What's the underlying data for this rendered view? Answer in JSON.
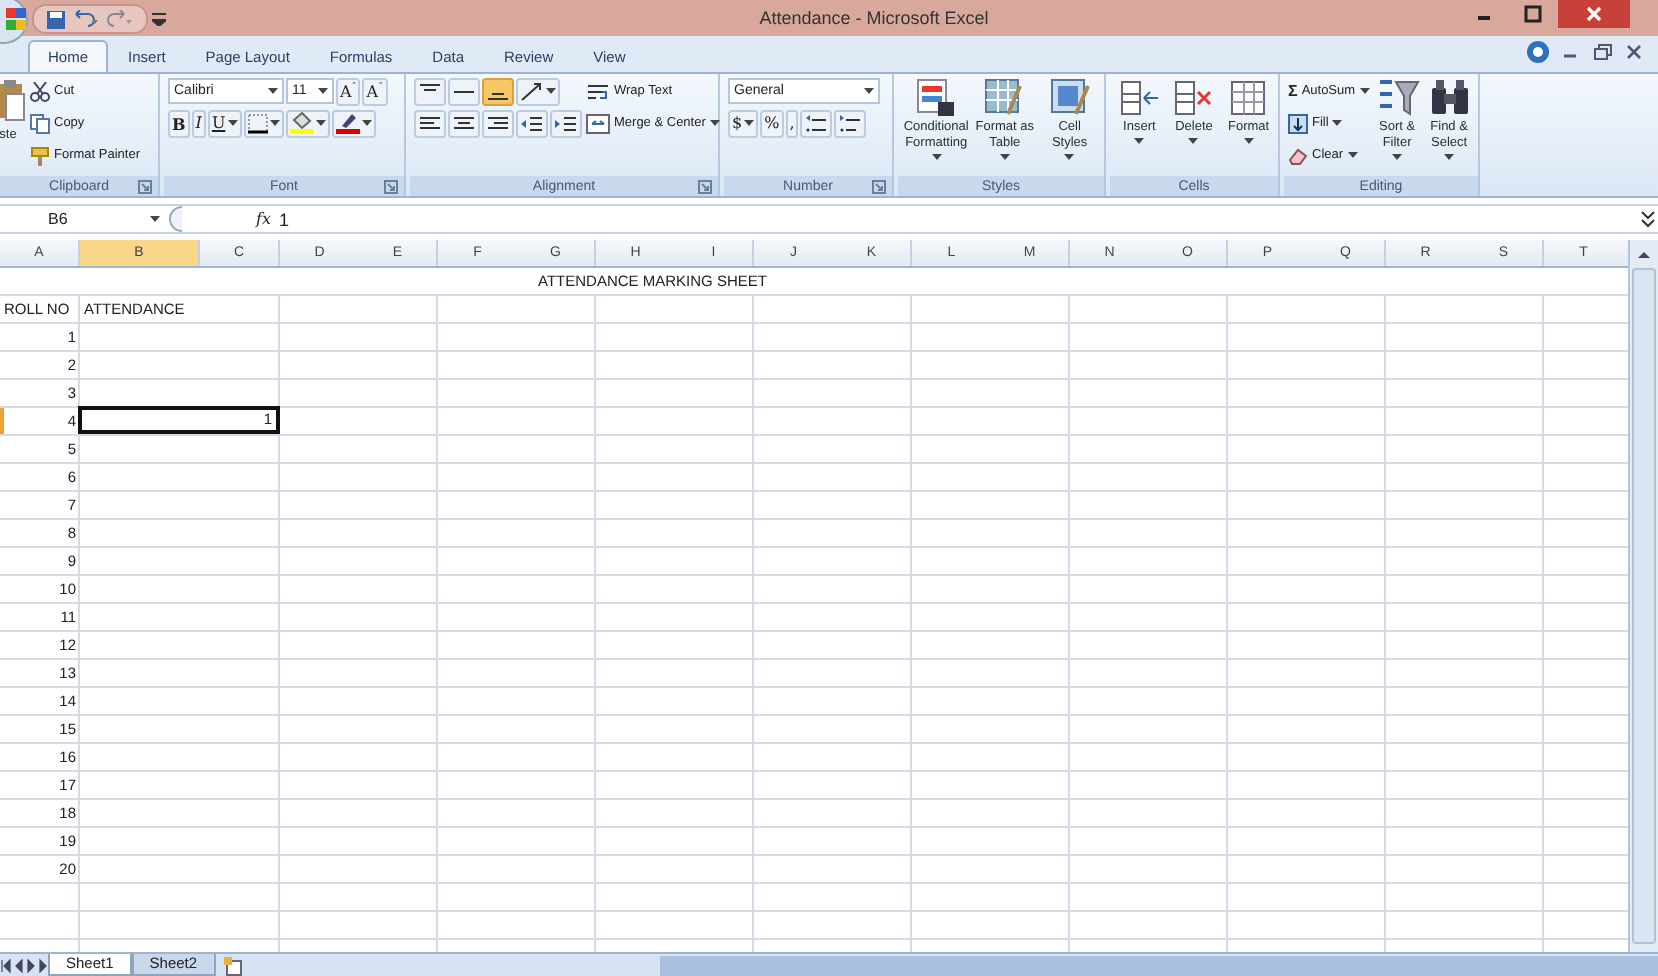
{
  "window": {
    "title": "Attendance - Microsoft Excel"
  },
  "ribbon_tabs": [
    {
      "label": "Home",
      "selected": true
    },
    {
      "label": "Insert",
      "selected": false
    },
    {
      "label": "Page Layout",
      "selected": false
    },
    {
      "label": "Formulas",
      "selected": false
    },
    {
      "label": "Data",
      "selected": false
    },
    {
      "label": "Review",
      "selected": false
    },
    {
      "label": "View",
      "selected": false
    }
  ],
  "ribbon": {
    "groups": [
      {
        "name": "Clipboard",
        "launcher": true,
        "items": [
          {
            "kind": "large",
            "label": "ste"
          },
          {
            "kind": "stack",
            "lines": [
              [
                {
                  "kind": "button",
                  "label": "Cut"
                }
              ],
              [
                {
                  "kind": "button",
                  "label": "Copy"
                }
              ],
              [
                {
                  "kind": "button",
                  "label": "Format Painter"
                }
              ]
            ]
          }
        ]
      },
      {
        "name": "Font",
        "launcher": true,
        "items": [
          {
            "kind": "stack",
            "lines": [
              [
                {
                  "kind": "combo",
                  "value": "Calibri"
                },
                {
                  "kind": "combo",
                  "value": "11"
                },
                {
                  "kind": "grow",
                  "label": "A$^{ˆ}$"
                },
                {
                  "kind": "shrink",
                  "label": "A$^{ˇ}$"
                }
              ],
              [
                {
                  "kind": "bold",
                  "label": "B"
                },
                {
                  "kind": "italic",
                  "label": "I"
                },
                {
                  "kind": "underline",
                  "label": "U",
                  "menu": true
                },
                {
                  "kind": "icon",
                  "menu": true
                },
                {
                  "kind": "icon",
                  "menu": true
                },
                {
                  "kind": "icon",
                  "menu": true
                }
              ]
            ]
          }
        ]
      },
      {
        "name": "Alignment",
        "launcher": true,
        "items": [
          {
            "kind": "stack",
            "lines": [
              [
                {
                  "kind": "icon",
                  "selected": false
                },
                {
                  "kind": "icon",
                  "selected": false
                },
                {
                  "kind": "icon",
                  "selected": true
                },
                {
                  "kind": "icon",
                  "menu": true,
                  "selected": false
                }
              ],
              [
                {
                  "kind": "icon"
                },
                {
                  "kind": "icon"
                },
                {
                  "kind": "icon"
                },
                {
                  "kind": "icon"
                },
                {
                  "kind": "icon"
                }
              ]
            ]
          },
          {
            "kind": "stack",
            "lines": [
              [
                {
                  "kind": "button",
                  "label": "Wrap Text"
                }
              ],
              [
                {
                  "kind": "button",
                  "label": "Merge & Center",
                  "menu": true
                }
              ]
            ]
          }
        ]
      },
      {
        "name": "Number",
        "launcher": true,
        "items": [
          {
            "kind": "stack",
            "lines": [
              [
                {
                  "kind": "combo",
                  "value": "General"
                }
              ],
              [
                {
                  "kind": "currency",
                  "label": "$",
                  "menu": true
                },
                {
                  "kind": "percent",
                  "label": "%"
                },
                {
                  "kind": "comma",
                  "label": ","
                },
                {
                  "kind": "icon"
                },
                {
                  "kind": "icon"
                }
              ]
            ]
          }
        ]
      },
      {
        "name": "Styles",
        "launcher": false,
        "items": [
          {
            "kind": "large",
            "label": "Conditional Formatting",
            "menu": true
          },
          {
            "kind": "large",
            "label": "Format as Table",
            "menu": true
          },
          {
            "kind": "large",
            "label": "Cell Styles",
            "menu": true
          }
        ]
      },
      {
        "name": "Cells",
        "launcher": false,
        "items": [
          {
            "kind": "large",
            "label": "Insert",
            "menu": true
          },
          {
            "kind": "large",
            "label": "Delete",
            "menu": true
          },
          {
            "kind": "large",
            "label": "Format",
            "menu": true
          }
        ]
      },
      {
        "name": "Editing",
        "launcher": false,
        "items": [
          {
            "kind": "stack",
            "lines": [
              [
                {
                  "kind": "button",
                  "glyph": "Σ",
                  "label": "AutoSum",
                  "menu": true
                }
              ],
              [
                {
                  "kind": "button",
                  "label": "Fill",
                  "menu": true
                }
              ],
              [
                {
                  "kind": "button",
                  "label": "Clear",
                  "menu": true
                }
              ]
            ]
          },
          {
            "kind": "large",
            "label": "Sort & Filter",
            "menu": true
          },
          {
            "kind": "large",
            "label": "Find & Select",
            "menu": true
          }
        ]
      }
    ]
  },
  "formula_bar": {
    "name_box": "B6",
    "fx": "fx",
    "value": "1"
  },
  "columns": [
    {
      "letter": "A",
      "selected": false
    },
    {
      "letter": "B",
      "selected": true
    },
    {
      "letter": "C",
      "selected": false
    },
    {
      "letter": "D",
      "selected": false
    },
    {
      "letter": "E",
      "selected": false
    },
    {
      "letter": "F",
      "selected": false
    },
    {
      "letter": "G",
      "selected": false
    },
    {
      "letter": "H",
      "selected": false
    },
    {
      "letter": "I",
      "selected": false
    },
    {
      "letter": "J",
      "selected": false
    },
    {
      "letter": "K",
      "selected": false
    },
    {
      "letter": "L",
      "selected": false
    },
    {
      "letter": "M",
      "selected": false
    },
    {
      "letter": "N",
      "selected": false
    },
    {
      "letter": "O",
      "selected": false
    },
    {
      "letter": "P",
      "selected": false
    },
    {
      "letter": "Q",
      "selected": false
    },
    {
      "letter": "R",
      "selected": false
    },
    {
      "letter": "S",
      "selected": false
    },
    {
      "letter": "T",
      "selected": false
    }
  ],
  "sheet": {
    "title": "ATTENDANCE MARKING SHEET",
    "header": [
      "ROLL NO",
      "ATTENDANCE"
    ],
    "rows": [
      {
        "roll": "1",
        "selected": false
      },
      {
        "roll": "2",
        "selected": false
      },
      {
        "roll": "3",
        "selected": false
      },
      {
        "roll": "4",
        "attendance": "1",
        "selected": true
      },
      {
        "roll": "5",
        "selected": false
      },
      {
        "roll": "6",
        "selected": false
      },
      {
        "roll": "7",
        "selected": false
      },
      {
        "roll": "8",
        "selected": false
      },
      {
        "roll": "9",
        "selected": false
      },
      {
        "roll": "10",
        "selected": false
      },
      {
        "roll": "11",
        "selected": false
      },
      {
        "roll": "12",
        "selected": false
      },
      {
        "roll": "13",
        "selected": false
      },
      {
        "roll": "14",
        "selected": false
      },
      {
        "roll": "15",
        "selected": false
      },
      {
        "roll": "16",
        "selected": false
      },
      {
        "roll": "17",
        "selected": false
      },
      {
        "roll": "18",
        "selected": false
      },
      {
        "roll": "19",
        "selected": false
      },
      {
        "roll": "20",
        "selected": false
      }
    ]
  },
  "sheet_tabs": [
    {
      "label": "Sheet1",
      "selected": true
    },
    {
      "label": "Sheet2",
      "selected": false
    }
  ]
}
